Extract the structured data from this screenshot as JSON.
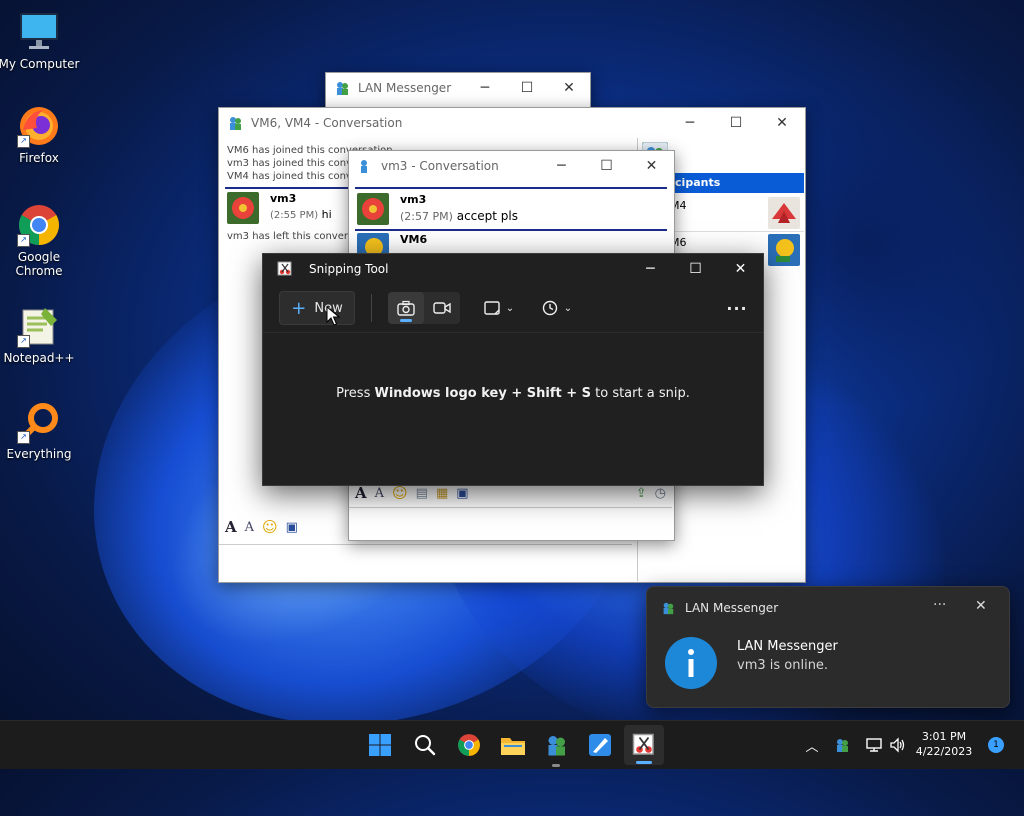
{
  "desktop": {
    "icons": [
      {
        "label": "My Computer"
      },
      {
        "label": "Firefox"
      },
      {
        "label": "Google Chrome"
      },
      {
        "label": "Notepad++"
      },
      {
        "label": "Everything"
      }
    ]
  },
  "lan_main": {
    "title": "LAN Messenger"
  },
  "conv_vm6_vm4": {
    "title": "VM6, VM4 - Conversation",
    "system_lines": [
      "VM6 has joined this conversation",
      "vm3 has joined this conve",
      "VM4 has joined this conve"
    ],
    "message": {
      "sender": "vm3",
      "time": "(2:55 PM)",
      "text": "hi"
    },
    "left_line": "vm3 has left this conversa",
    "participants_header": "ticipants",
    "participants": [
      {
        "name": "M4"
      },
      {
        "name": "M6"
      }
    ]
  },
  "conv_vm3": {
    "title": "vm3 - Conversation",
    "messages": [
      {
        "sender": "vm3",
        "time": "(2:57 PM)",
        "text": "accept pls"
      },
      {
        "sender": "VM6",
        "time": "",
        "text": ""
      }
    ]
  },
  "snipping_tool": {
    "title": "Snipping Tool",
    "new_label": "New",
    "hint": {
      "pre": "Press ",
      "keys": "Windows logo key + Shift + S",
      "post": " to start a snip."
    }
  },
  "toast": {
    "app": "LAN Messenger",
    "title": "LAN Messenger",
    "body": "vm3 is online.",
    "more": "···"
  },
  "taskbar": {
    "time": "3:01 PM",
    "date": "4/22/2023",
    "notification_count": "1"
  },
  "colors": {
    "accent": "#0067c0",
    "participants_bar": "#0a5cd6",
    "snip_bg": "#202020",
    "taskbar_bg": "#1c1c1c",
    "toast_bg": "#2b2b2b",
    "info_icon": "#1e88d8"
  }
}
